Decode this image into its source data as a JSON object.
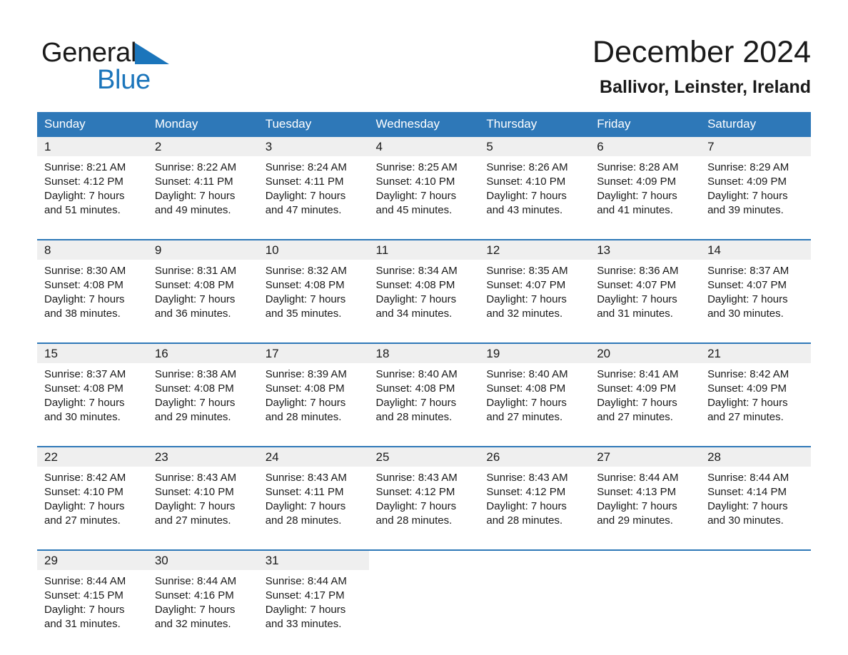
{
  "brand": {
    "name_part1": "General",
    "name_part2": "Blue",
    "triangle_color": "#1b75bb",
    "logo_icon": "general-blue-triangle-icon"
  },
  "header": {
    "title": "December 2024",
    "location": "Ballivor, Leinster, Ireland"
  },
  "theme": {
    "header_blue": "#2e78b8",
    "daynum_band": "#efefef",
    "text": "#1a1a1a"
  },
  "weekdays": [
    "Sunday",
    "Monday",
    "Tuesday",
    "Wednesday",
    "Thursday",
    "Friday",
    "Saturday"
  ],
  "labels": {
    "sunrise_prefix": "Sunrise:",
    "sunset_prefix": "Sunset:",
    "daylight_prefix": "Daylight:"
  },
  "weeks": [
    [
      {
        "day": "1",
        "sunrise": "Sunrise: 8:21 AM",
        "sunset": "Sunset: 4:12 PM",
        "daylight1": "Daylight: 7 hours",
        "daylight2": "and 51 minutes."
      },
      {
        "day": "2",
        "sunrise": "Sunrise: 8:22 AM",
        "sunset": "Sunset: 4:11 PM",
        "daylight1": "Daylight: 7 hours",
        "daylight2": "and 49 minutes."
      },
      {
        "day": "3",
        "sunrise": "Sunrise: 8:24 AM",
        "sunset": "Sunset: 4:11 PM",
        "daylight1": "Daylight: 7 hours",
        "daylight2": "and 47 minutes."
      },
      {
        "day": "4",
        "sunrise": "Sunrise: 8:25 AM",
        "sunset": "Sunset: 4:10 PM",
        "daylight1": "Daylight: 7 hours",
        "daylight2": "and 45 minutes."
      },
      {
        "day": "5",
        "sunrise": "Sunrise: 8:26 AM",
        "sunset": "Sunset: 4:10 PM",
        "daylight1": "Daylight: 7 hours",
        "daylight2": "and 43 minutes."
      },
      {
        "day": "6",
        "sunrise": "Sunrise: 8:28 AM",
        "sunset": "Sunset: 4:09 PM",
        "daylight1": "Daylight: 7 hours",
        "daylight2": "and 41 minutes."
      },
      {
        "day": "7",
        "sunrise": "Sunrise: 8:29 AM",
        "sunset": "Sunset: 4:09 PM",
        "daylight1": "Daylight: 7 hours",
        "daylight2": "and 39 minutes."
      }
    ],
    [
      {
        "day": "8",
        "sunrise": "Sunrise: 8:30 AM",
        "sunset": "Sunset: 4:08 PM",
        "daylight1": "Daylight: 7 hours",
        "daylight2": "and 38 minutes."
      },
      {
        "day": "9",
        "sunrise": "Sunrise: 8:31 AM",
        "sunset": "Sunset: 4:08 PM",
        "daylight1": "Daylight: 7 hours",
        "daylight2": "and 36 minutes."
      },
      {
        "day": "10",
        "sunrise": "Sunrise: 8:32 AM",
        "sunset": "Sunset: 4:08 PM",
        "daylight1": "Daylight: 7 hours",
        "daylight2": "and 35 minutes."
      },
      {
        "day": "11",
        "sunrise": "Sunrise: 8:34 AM",
        "sunset": "Sunset: 4:08 PM",
        "daylight1": "Daylight: 7 hours",
        "daylight2": "and 34 minutes."
      },
      {
        "day": "12",
        "sunrise": "Sunrise: 8:35 AM",
        "sunset": "Sunset: 4:07 PM",
        "daylight1": "Daylight: 7 hours",
        "daylight2": "and 32 minutes."
      },
      {
        "day": "13",
        "sunrise": "Sunrise: 8:36 AM",
        "sunset": "Sunset: 4:07 PM",
        "daylight1": "Daylight: 7 hours",
        "daylight2": "and 31 minutes."
      },
      {
        "day": "14",
        "sunrise": "Sunrise: 8:37 AM",
        "sunset": "Sunset: 4:07 PM",
        "daylight1": "Daylight: 7 hours",
        "daylight2": "and 30 minutes."
      }
    ],
    [
      {
        "day": "15",
        "sunrise": "Sunrise: 8:37 AM",
        "sunset": "Sunset: 4:08 PM",
        "daylight1": "Daylight: 7 hours",
        "daylight2": "and 30 minutes."
      },
      {
        "day": "16",
        "sunrise": "Sunrise: 8:38 AM",
        "sunset": "Sunset: 4:08 PM",
        "daylight1": "Daylight: 7 hours",
        "daylight2": "and 29 minutes."
      },
      {
        "day": "17",
        "sunrise": "Sunrise: 8:39 AM",
        "sunset": "Sunset: 4:08 PM",
        "daylight1": "Daylight: 7 hours",
        "daylight2": "and 28 minutes."
      },
      {
        "day": "18",
        "sunrise": "Sunrise: 8:40 AM",
        "sunset": "Sunset: 4:08 PM",
        "daylight1": "Daylight: 7 hours",
        "daylight2": "and 28 minutes."
      },
      {
        "day": "19",
        "sunrise": "Sunrise: 8:40 AM",
        "sunset": "Sunset: 4:08 PM",
        "daylight1": "Daylight: 7 hours",
        "daylight2": "and 27 minutes."
      },
      {
        "day": "20",
        "sunrise": "Sunrise: 8:41 AM",
        "sunset": "Sunset: 4:09 PM",
        "daylight1": "Daylight: 7 hours",
        "daylight2": "and 27 minutes."
      },
      {
        "day": "21",
        "sunrise": "Sunrise: 8:42 AM",
        "sunset": "Sunset: 4:09 PM",
        "daylight1": "Daylight: 7 hours",
        "daylight2": "and 27 minutes."
      }
    ],
    [
      {
        "day": "22",
        "sunrise": "Sunrise: 8:42 AM",
        "sunset": "Sunset: 4:10 PM",
        "daylight1": "Daylight: 7 hours",
        "daylight2": "and 27 minutes."
      },
      {
        "day": "23",
        "sunrise": "Sunrise: 8:43 AM",
        "sunset": "Sunset: 4:10 PM",
        "daylight1": "Daylight: 7 hours",
        "daylight2": "and 27 minutes."
      },
      {
        "day": "24",
        "sunrise": "Sunrise: 8:43 AM",
        "sunset": "Sunset: 4:11 PM",
        "daylight1": "Daylight: 7 hours",
        "daylight2": "and 28 minutes."
      },
      {
        "day": "25",
        "sunrise": "Sunrise: 8:43 AM",
        "sunset": "Sunset: 4:12 PM",
        "daylight1": "Daylight: 7 hours",
        "daylight2": "and 28 minutes."
      },
      {
        "day": "26",
        "sunrise": "Sunrise: 8:43 AM",
        "sunset": "Sunset: 4:12 PM",
        "daylight1": "Daylight: 7 hours",
        "daylight2": "and 28 minutes."
      },
      {
        "day": "27",
        "sunrise": "Sunrise: 8:44 AM",
        "sunset": "Sunset: 4:13 PM",
        "daylight1": "Daylight: 7 hours",
        "daylight2": "and 29 minutes."
      },
      {
        "day": "28",
        "sunrise": "Sunrise: 8:44 AM",
        "sunset": "Sunset: 4:14 PM",
        "daylight1": "Daylight: 7 hours",
        "daylight2": "and 30 minutes."
      }
    ],
    [
      {
        "day": "29",
        "sunrise": "Sunrise: 8:44 AM",
        "sunset": "Sunset: 4:15 PM",
        "daylight1": "Daylight: 7 hours",
        "daylight2": "and 31 minutes."
      },
      {
        "day": "30",
        "sunrise": "Sunrise: 8:44 AM",
        "sunset": "Sunset: 4:16 PM",
        "daylight1": "Daylight: 7 hours",
        "daylight2": "and 32 minutes."
      },
      {
        "day": "31",
        "sunrise": "Sunrise: 8:44 AM",
        "sunset": "Sunset: 4:17 PM",
        "daylight1": "Daylight: 7 hours",
        "daylight2": "and 33 minutes."
      },
      {
        "day": "",
        "sunrise": "",
        "sunset": "",
        "daylight1": "",
        "daylight2": ""
      },
      {
        "day": "",
        "sunrise": "",
        "sunset": "",
        "daylight1": "",
        "daylight2": ""
      },
      {
        "day": "",
        "sunrise": "",
        "sunset": "",
        "daylight1": "",
        "daylight2": ""
      },
      {
        "day": "",
        "sunrise": "",
        "sunset": "",
        "daylight1": "",
        "daylight2": ""
      }
    ]
  ]
}
